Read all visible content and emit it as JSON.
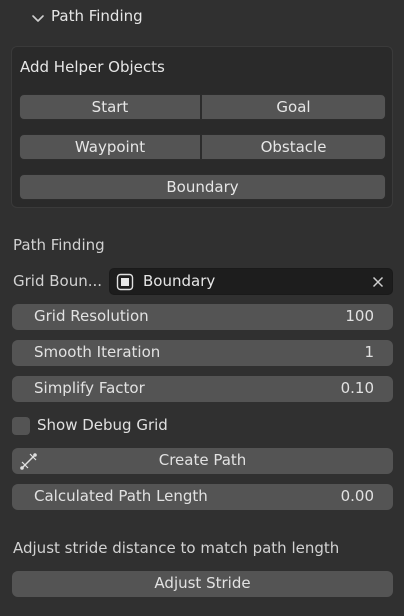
{
  "panel": {
    "title": "Path Finding"
  },
  "helpers": {
    "heading": "Add Helper Objects",
    "start": "Start",
    "goal": "Goal",
    "waypoint": "Waypoint",
    "obstacle": "Obstacle",
    "boundary": "Boundary"
  },
  "path_finding": {
    "section_label": "Path Finding",
    "grid_boundary_label": "Grid Boun...",
    "grid_boundary_value": "Boundary",
    "grid_resolution_label": "Grid Resolution",
    "grid_resolution_value": "100",
    "smooth_iteration_label": "Smooth Iteration",
    "smooth_iteration_value": "1",
    "simplify_factor_label": "Simplify Factor",
    "simplify_factor_value": "0.10",
    "show_debug_grid_label": "Show Debug Grid",
    "create_path_label": "Create Path",
    "calc_length_label": "Calculated Path Length",
    "calc_length_value": "0.00",
    "adjust_hint": "Adjust stride distance to match path length",
    "adjust_stride_label": "Adjust Stride"
  }
}
